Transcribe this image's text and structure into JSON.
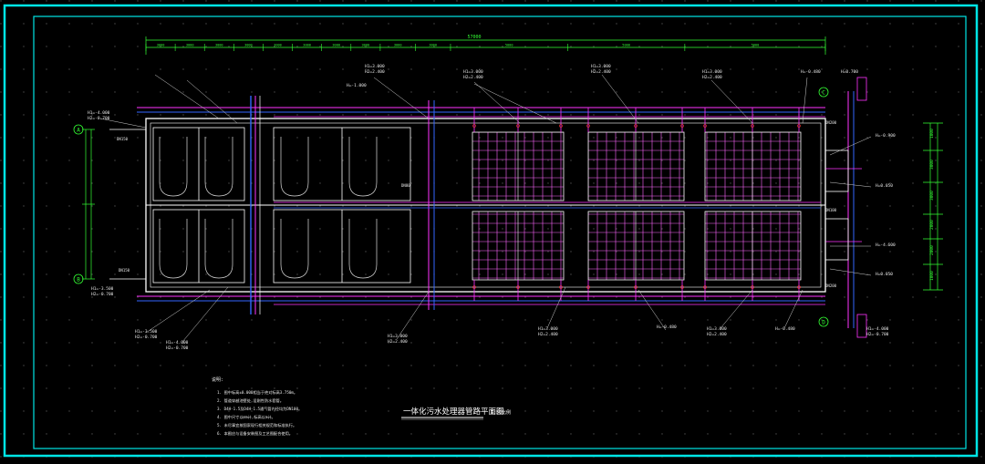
{
  "drawing": {
    "title": "一体化污水处理器管路平面图",
    "scale_note": "1:50比例",
    "notes_heading": "说明:",
    "notes": [
      "1. 图中标高±0.000相当于绝对标高3.750m。",
      "2. 管道穿越池壁处,设刚性防水套管。",
      "3. D4H-1.5及D4H-1.5通气管内径均为DN100。",
      "4. 图中尺寸以mm计,标高以m计。",
      "5. 未尽事宜按国家现行相关规范和标准执行。",
      "6. 本图应与设备安装图及工艺图配合使用。"
    ],
    "overall_dimension": "57000",
    "top_dimensions": [
      "3000",
      "3000",
      "3000",
      "3000",
      "3000",
      "3000",
      "3000",
      "3000",
      "3000",
      "3000",
      "5000",
      "5000",
      "5000"
    ],
    "axis_labels": [
      "A",
      "B",
      "C",
      "D"
    ],
    "right_dimensions": [
      "1000",
      "3000",
      "3000",
      "2000",
      "2000",
      "1000"
    ],
    "level_labels": [
      "H1=-4.000",
      "H2=-0.700",
      "H=-1.000",
      "H1=-3.500",
      "H2=-0.700",
      "H=-0.480",
      "H=0.700",
      "H1=3.000",
      "H2=2.400",
      "H=-0.900",
      "H=0.050",
      "H=-4.600"
    ],
    "pipe_labels": [
      "DN50",
      "DN80",
      "DN100",
      "DN150",
      "DN200"
    ]
  },
  "colors": {
    "frame": "#00e5e5",
    "dim_green": "#33ff33",
    "wall_white": "#ffffff",
    "pipe_magenta": "#ff33ff",
    "pipe_blue": "#3366ff",
    "label_white": "#e8e8e8",
    "accent_red": "#ff3333",
    "grid_dot": "#555555"
  }
}
